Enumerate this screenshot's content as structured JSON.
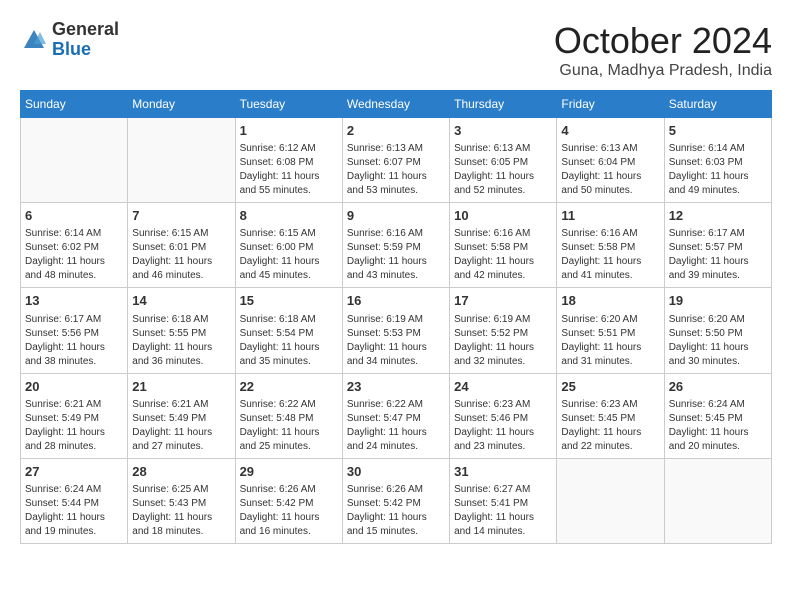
{
  "header": {
    "logo": {
      "general": "General",
      "blue": "Blue"
    },
    "title": "October 2024",
    "subtitle": "Guna, Madhya Pradesh, India"
  },
  "weekdays": [
    "Sunday",
    "Monday",
    "Tuesday",
    "Wednesday",
    "Thursday",
    "Friday",
    "Saturday"
  ],
  "weeks": [
    [
      {
        "day": "",
        "info": ""
      },
      {
        "day": "",
        "info": ""
      },
      {
        "day": "1",
        "info": "Sunrise: 6:12 AM\nSunset: 6:08 PM\nDaylight: 11 hours and 55 minutes."
      },
      {
        "day": "2",
        "info": "Sunrise: 6:13 AM\nSunset: 6:07 PM\nDaylight: 11 hours and 53 minutes."
      },
      {
        "day": "3",
        "info": "Sunrise: 6:13 AM\nSunset: 6:05 PM\nDaylight: 11 hours and 52 minutes."
      },
      {
        "day": "4",
        "info": "Sunrise: 6:13 AM\nSunset: 6:04 PM\nDaylight: 11 hours and 50 minutes."
      },
      {
        "day": "5",
        "info": "Sunrise: 6:14 AM\nSunset: 6:03 PM\nDaylight: 11 hours and 49 minutes."
      }
    ],
    [
      {
        "day": "6",
        "info": "Sunrise: 6:14 AM\nSunset: 6:02 PM\nDaylight: 11 hours and 48 minutes."
      },
      {
        "day": "7",
        "info": "Sunrise: 6:15 AM\nSunset: 6:01 PM\nDaylight: 11 hours and 46 minutes."
      },
      {
        "day": "8",
        "info": "Sunrise: 6:15 AM\nSunset: 6:00 PM\nDaylight: 11 hours and 45 minutes."
      },
      {
        "day": "9",
        "info": "Sunrise: 6:16 AM\nSunset: 5:59 PM\nDaylight: 11 hours and 43 minutes."
      },
      {
        "day": "10",
        "info": "Sunrise: 6:16 AM\nSunset: 5:58 PM\nDaylight: 11 hours and 42 minutes."
      },
      {
        "day": "11",
        "info": "Sunrise: 6:16 AM\nSunset: 5:58 PM\nDaylight: 11 hours and 41 minutes."
      },
      {
        "day": "12",
        "info": "Sunrise: 6:17 AM\nSunset: 5:57 PM\nDaylight: 11 hours and 39 minutes."
      }
    ],
    [
      {
        "day": "13",
        "info": "Sunrise: 6:17 AM\nSunset: 5:56 PM\nDaylight: 11 hours and 38 minutes."
      },
      {
        "day": "14",
        "info": "Sunrise: 6:18 AM\nSunset: 5:55 PM\nDaylight: 11 hours and 36 minutes."
      },
      {
        "day": "15",
        "info": "Sunrise: 6:18 AM\nSunset: 5:54 PM\nDaylight: 11 hours and 35 minutes."
      },
      {
        "day": "16",
        "info": "Sunrise: 6:19 AM\nSunset: 5:53 PM\nDaylight: 11 hours and 34 minutes."
      },
      {
        "day": "17",
        "info": "Sunrise: 6:19 AM\nSunset: 5:52 PM\nDaylight: 11 hours and 32 minutes."
      },
      {
        "day": "18",
        "info": "Sunrise: 6:20 AM\nSunset: 5:51 PM\nDaylight: 11 hours and 31 minutes."
      },
      {
        "day": "19",
        "info": "Sunrise: 6:20 AM\nSunset: 5:50 PM\nDaylight: 11 hours and 30 minutes."
      }
    ],
    [
      {
        "day": "20",
        "info": "Sunrise: 6:21 AM\nSunset: 5:49 PM\nDaylight: 11 hours and 28 minutes."
      },
      {
        "day": "21",
        "info": "Sunrise: 6:21 AM\nSunset: 5:49 PM\nDaylight: 11 hours and 27 minutes."
      },
      {
        "day": "22",
        "info": "Sunrise: 6:22 AM\nSunset: 5:48 PM\nDaylight: 11 hours and 25 minutes."
      },
      {
        "day": "23",
        "info": "Sunrise: 6:22 AM\nSunset: 5:47 PM\nDaylight: 11 hours and 24 minutes."
      },
      {
        "day": "24",
        "info": "Sunrise: 6:23 AM\nSunset: 5:46 PM\nDaylight: 11 hours and 23 minutes."
      },
      {
        "day": "25",
        "info": "Sunrise: 6:23 AM\nSunset: 5:45 PM\nDaylight: 11 hours and 22 minutes."
      },
      {
        "day": "26",
        "info": "Sunrise: 6:24 AM\nSunset: 5:45 PM\nDaylight: 11 hours and 20 minutes."
      }
    ],
    [
      {
        "day": "27",
        "info": "Sunrise: 6:24 AM\nSunset: 5:44 PM\nDaylight: 11 hours and 19 minutes."
      },
      {
        "day": "28",
        "info": "Sunrise: 6:25 AM\nSunset: 5:43 PM\nDaylight: 11 hours and 18 minutes."
      },
      {
        "day": "29",
        "info": "Sunrise: 6:26 AM\nSunset: 5:42 PM\nDaylight: 11 hours and 16 minutes."
      },
      {
        "day": "30",
        "info": "Sunrise: 6:26 AM\nSunset: 5:42 PM\nDaylight: 11 hours and 15 minutes."
      },
      {
        "day": "31",
        "info": "Sunrise: 6:27 AM\nSunset: 5:41 PM\nDaylight: 11 hours and 14 minutes."
      },
      {
        "day": "",
        "info": ""
      },
      {
        "day": "",
        "info": ""
      }
    ]
  ]
}
